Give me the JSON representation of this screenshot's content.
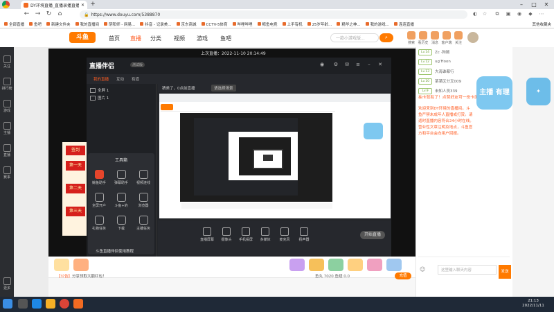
{
  "browser": {
    "tab_title": "DY环境直播_直播录播直播_斗鱼...",
    "url": "https://www.douyu.com/5388870",
    "new_tab_glyph": "+",
    "bookmarks": [
      "全部直播",
      "鱼吧",
      "新建文件夹",
      "我的直播间",
      "阴阳师 - 网易...",
      "抖音 - 记录美...",
      "京东商城",
      "CCTV-5体育",
      "哔哩哔哩",
      "鲸鱼电竞",
      "上手有机",
      "25岁年龄...",
      "精华之神...",
      "我的游戏...",
      "连连直播"
    ],
    "other_bookmarks": "其他收藏夹"
  },
  "site": {
    "logo_text": "斗鱼",
    "nav": [
      "首页",
      "直播",
      "分类",
      "视频",
      "游戏",
      "鱼吧"
    ],
    "active_nav": "直播",
    "search_placeholder": "一款小游戏版...",
    "header_icons": [
      "搜索",
      "看历史",
      "消息",
      "客户端",
      "关注",
      "开播"
    ]
  },
  "left_sidebar": [
    "关注",
    "排行榜",
    "游戏",
    "主播",
    "直播",
    "赛事",
    "更多"
  ],
  "player": {
    "live_since": "上次直播：2022-11-10 20:14:49"
  },
  "app": {
    "name": "直播伴侣",
    "version": "测试版",
    "tabs": [
      "我的直播",
      "互动",
      "有道"
    ],
    "active_tab": "我的直播",
    "scenes": [
      "全屏 1",
      "图片 1"
    ],
    "tools_title": "工具箱",
    "tools": [
      "鲸鱼助手",
      "弹幕助手",
      "视频连线",
      "全屏开户",
      "斗鱼+的",
      "浏览器",
      "礼物任务",
      "下载",
      "主播任务"
    ],
    "preview_header": "猜美了，0点前直播",
    "preview_btn": "请选择场景",
    "controls": [
      "直播屏幕",
      "摄像头",
      "手机投屏",
      "多媒体",
      "麦克风",
      "扬声器"
    ],
    "start_button": "开始直播",
    "notice": "斗鱼直播伴侣使用教程"
  },
  "promo": [
    "签到",
    "第一天",
    "第二天",
    "第三天"
  ],
  "room": {
    "announcement_tag": "【公告】",
    "announcement": "分享领取大额红包！",
    "fish_balls": "鱼丸 7020",
    "fish_fins": "鱼翅 0.0",
    "charge": "充值"
  },
  "right_panel": {
    "ranking": [
      {
        "level": "Lv.14",
        "name": "Zc ·狗婉"
      },
      {
        "level": "Lv.12",
        "name": "ug'Hoon"
      },
      {
        "level": "Lv.13",
        "name": "大海谁都行"
      },
      {
        "level": "Lv.10",
        "name": "某某区分叉009"
      },
      {
        "level": "Lv.9",
        "name": "未知人员339"
      }
    ],
    "notice": "抽卡就有了！点赞好友可一份卡面票十套",
    "welcome": "欢迎来到DY环境的直播间。斗鱼严禁未成年人直播或打赏。请适时直播内容符合24小时在线。营业性文章注明及地点，斗鱼官方和平台会向用户回报。",
    "sticker_text": "主播 有理",
    "chat_placeholder": "这里输入聊天内容",
    "send": "发送"
  },
  "taskbar": {
    "time": "21:13",
    "date": "2022/11/11"
  }
}
